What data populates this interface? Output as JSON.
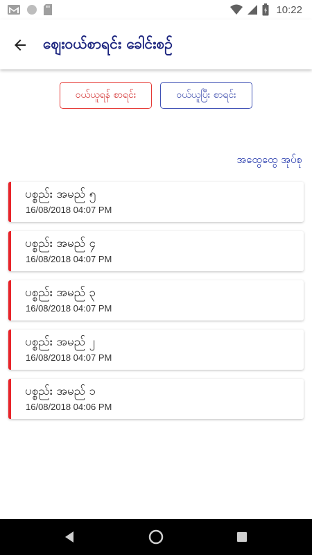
{
  "status_bar": {
    "time": "10:22",
    "icons": [
      "gmail-icon",
      "circle-icon",
      "sd-card-icon",
      "wifi-icon",
      "signal-icon",
      "battery-icon"
    ]
  },
  "app_bar": {
    "title": "ဈေးဝယ်စာရင်း ခေါင်းစဉ်",
    "back_icon": "arrow-back-icon",
    "title_color": "#1a237e"
  },
  "buttons": {
    "to_buy": "ဝယ်ယူရန် စာရင်း",
    "bought": "ဝယ်ယူပြီး စာရင်း"
  },
  "group_link": "အထွေထွေ အုပ်စု",
  "accent_colors": {
    "red": "#e8242a",
    "blue": "#3949ab"
  },
  "items": [
    {
      "title": "ပစ္စည်း အမည် ၅",
      "date": "16/08/2018 04:07 PM"
    },
    {
      "title": "ပစ္စည်း အမည် ၄",
      "date": "16/08/2018 04:07 PM"
    },
    {
      "title": "ပစ္စည်း အမည် ၃",
      "date": "16/08/2018 04:07 PM"
    },
    {
      "title": "ပစ္စည်း အမည် ၂",
      "date": "16/08/2018 04:07 PM"
    },
    {
      "title": "ပစ္စည်း အမည် ၁",
      "date": "16/08/2018 04:06 PM"
    }
  ],
  "nav_bar": {
    "icons": [
      "back-triangle-icon",
      "home-circle-icon",
      "recents-square-icon"
    ]
  }
}
